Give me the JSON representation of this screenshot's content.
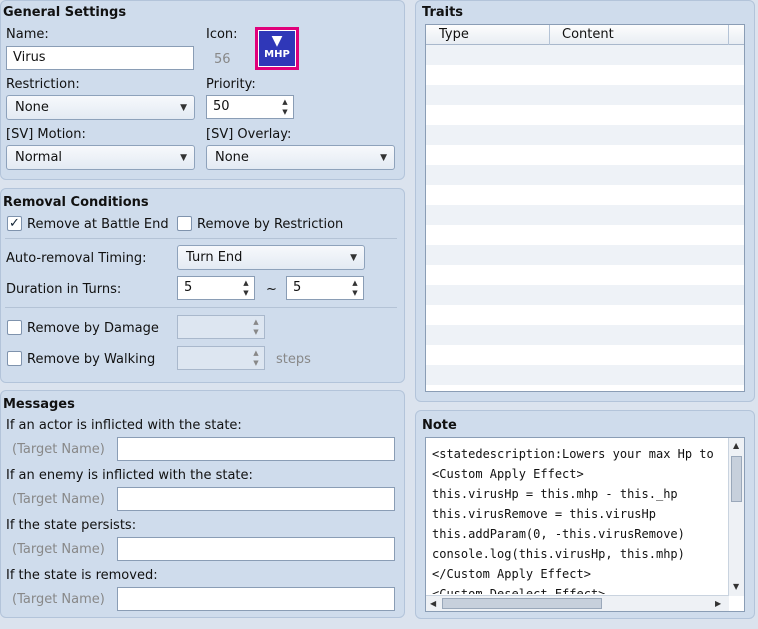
{
  "general": {
    "title": "General Settings",
    "name_label": "Name:",
    "name_value": "Virus",
    "icon_label": "Icon:",
    "icon_index": "56",
    "icon_text": "MHP",
    "restriction_label": "Restriction:",
    "restriction_value": "None",
    "priority_label": "Priority:",
    "priority_value": "50",
    "motion_label": "[SV] Motion:",
    "motion_value": "Normal",
    "overlay_label": "[SV] Overlay:",
    "overlay_value": "None"
  },
  "removal": {
    "title": "Removal Conditions",
    "battle_end_label": "Remove at Battle End",
    "battle_end_checked": true,
    "restriction_label": "Remove by Restriction",
    "restriction_checked": false,
    "timing_label": "Auto-removal Timing:",
    "timing_value": "Turn End",
    "duration_label": "Duration in Turns:",
    "duration_min": "5",
    "duration_tilde": "~",
    "duration_max": "5",
    "damage_label": "Remove by Damage",
    "damage_checked": false,
    "walking_label": "Remove by Walking",
    "walking_checked": false,
    "steps_label": "steps"
  },
  "messages": {
    "title": "Messages",
    "items": [
      {
        "label": "If an actor is inflicted with the state:",
        "placeholder": "(Target Name)",
        "value": ""
      },
      {
        "label": "If an enemy is inflicted with the state:",
        "placeholder": "(Target Name)",
        "value": ""
      },
      {
        "label": "If the state persists:",
        "placeholder": "(Target Name)",
        "value": ""
      },
      {
        "label": "If the state is removed:",
        "placeholder": "(Target Name)",
        "value": ""
      }
    ]
  },
  "traits": {
    "title": "Traits",
    "col_type": "Type",
    "col_content": "Content"
  },
  "note": {
    "title": "Note",
    "text": "<statedescription:Lowers your max Hp to be\n<Custom Apply Effect>\nthis.virusHp = this.mhp - this._hp\nthis.virusRemove = this.virusHp\nthis.addParam(0, -this.virusRemove)\nconsole.log(this.virusHp, this.mhp)\n</Custom Apply Effect>\n<Custom Deselect Effect>"
  },
  "colors": {
    "panel_bg": "#cfdcec",
    "window_bg": "#dbe3ee",
    "icon_border": "#e0007a",
    "icon_fill": "#2f37b8"
  }
}
